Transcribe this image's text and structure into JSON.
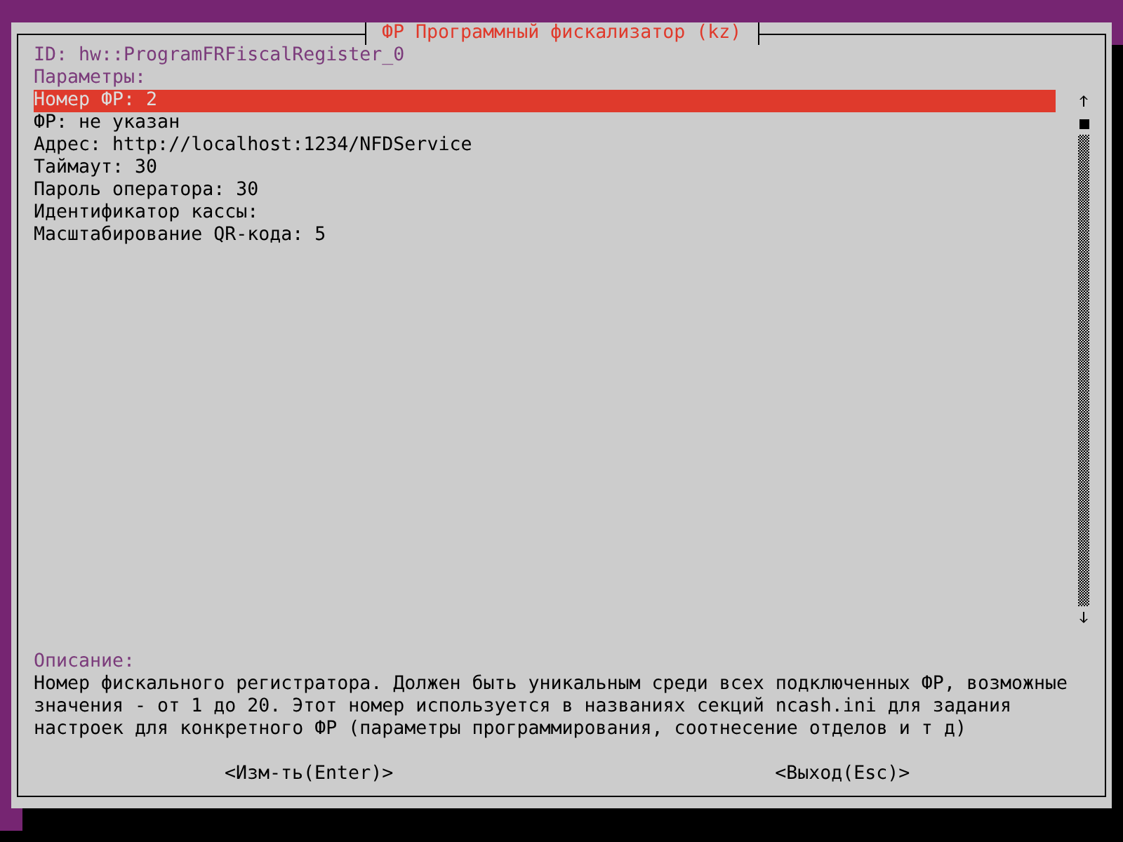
{
  "window": {
    "title": "ФР Программный фискализатор (kz)"
  },
  "id_line": "ID: hw::ProgramFRFiscalRegister_0",
  "parameters": {
    "heading": "Параметры:",
    "items": [
      {
        "label": "Номер ФР: 2",
        "selected": true
      },
      {
        "label": "ФР: не указан",
        "selected": false
      },
      {
        "label": "Адрес: http://localhost:1234/NFDService",
        "selected": false
      },
      {
        "label": "Таймаут: 30",
        "selected": false
      },
      {
        "label": "Пароль оператора: 30",
        "selected": false
      },
      {
        "label": "Идентификатор кассы:",
        "selected": false
      },
      {
        "label": "Масштабирование QR-кода: 5",
        "selected": false
      }
    ]
  },
  "description": {
    "heading": "Описание:",
    "text": "Номер фискального регистратора. Должен быть уникальным среди всех подключенных ФР, возможные значения - от 1 до 20. Этот номер используется в названиях секций ncash.ini для задания настроек для конкретного ФР (параметры программирования, соотнесение отделов и т д)"
  },
  "buttons": [
    "<Изм-ть(Enter)>",
    "<Выход(Esc)>"
  ]
}
